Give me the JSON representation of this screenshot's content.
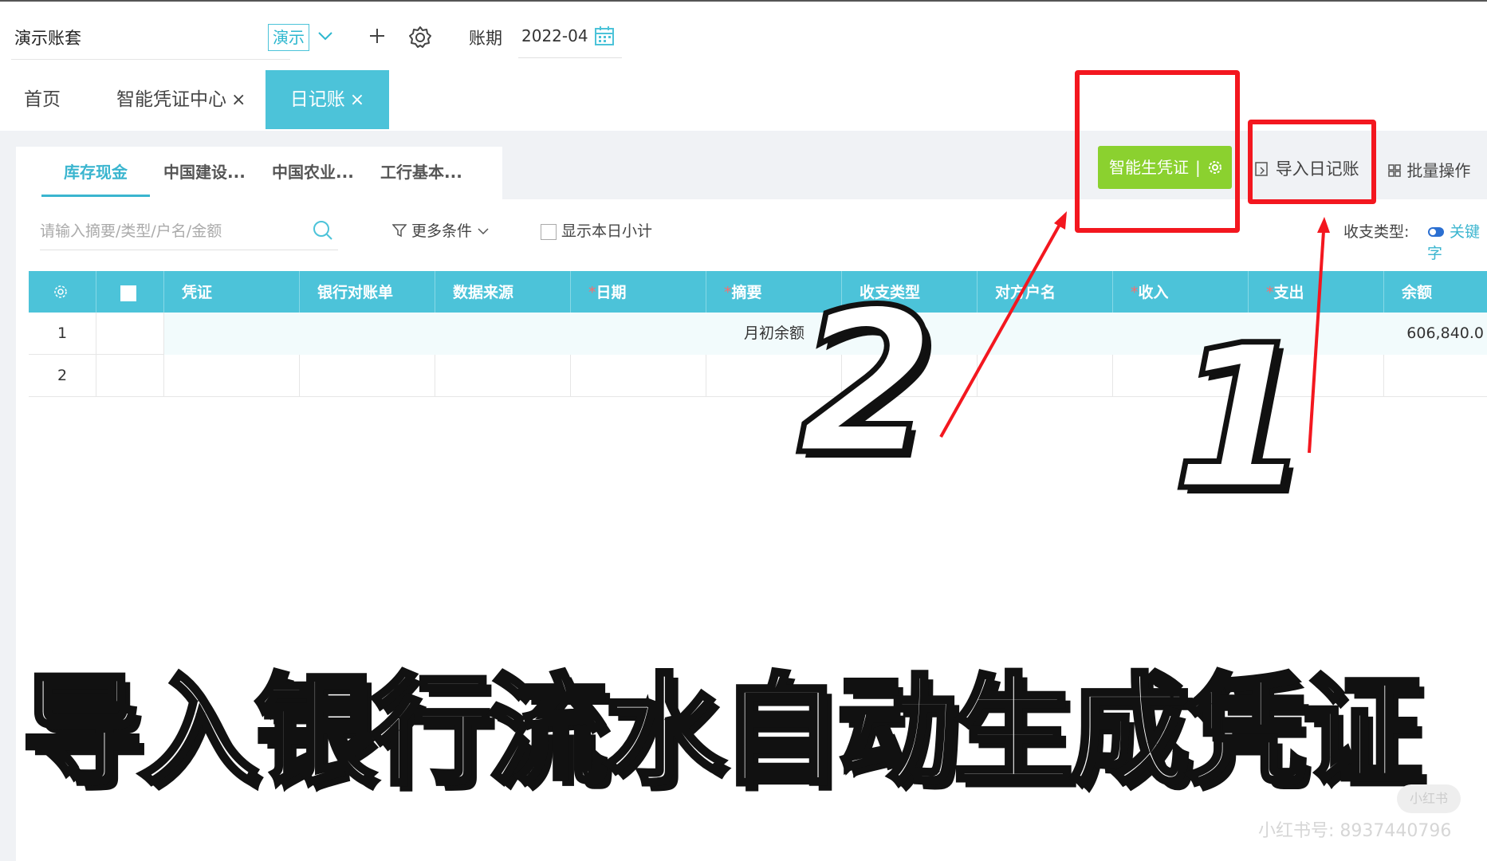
{
  "topbar": {
    "company": "演示账套",
    "demo_tag": "演示",
    "period_label": "账期",
    "period_value": "2022-04"
  },
  "tabs": {
    "home": "首页",
    "smart_center": "智能凭证中心",
    "journal": "日记账",
    "close_glyph": "×"
  },
  "subtabs": [
    "库存现金",
    "中国建设...",
    "中国农业...",
    "工行基本..."
  ],
  "toolbar": {
    "smart_voucher": "智能生凭证",
    "smart_sep": "|",
    "import_journal": "导入日记账",
    "batch_ops": "批量操作",
    "search_placeholder": "请输入摘要/类型/户名/金额",
    "more_filter": "更多条件",
    "show_subtotal": "显示本日小计",
    "type_label": "收支类型:",
    "keyword": "关键字"
  },
  "table": {
    "columns": [
      {
        "label": "凭证",
        "required": false
      },
      {
        "label": "银行对账单",
        "required": false
      },
      {
        "label": "数据来源",
        "required": false
      },
      {
        "label": "日期",
        "required": true
      },
      {
        "label": "摘要",
        "required": true
      },
      {
        "label": "收支类型",
        "required": false
      },
      {
        "label": "对方户名",
        "required": false
      },
      {
        "label": "收入",
        "required": true
      },
      {
        "label": "支出",
        "required": true
      },
      {
        "label": "余额",
        "required": false
      }
    ],
    "rows": [
      {
        "index": "1",
        "summary": "月初余额",
        "balance": "606,840.0"
      },
      {
        "index": "2",
        "summary": "",
        "balance": ""
      }
    ]
  },
  "overlay": {
    "num_2": "2",
    "num_1": "1",
    "caption": "导入银行流水自动生成凭证",
    "watermark": "小红书号: 8937440796",
    "logo": "小红书",
    "annotation_color": "#f3171f"
  },
  "colors": {
    "accent": "#4cc3d9",
    "green_button": "#8bd12f",
    "required_star": "#ff6a6a"
  }
}
